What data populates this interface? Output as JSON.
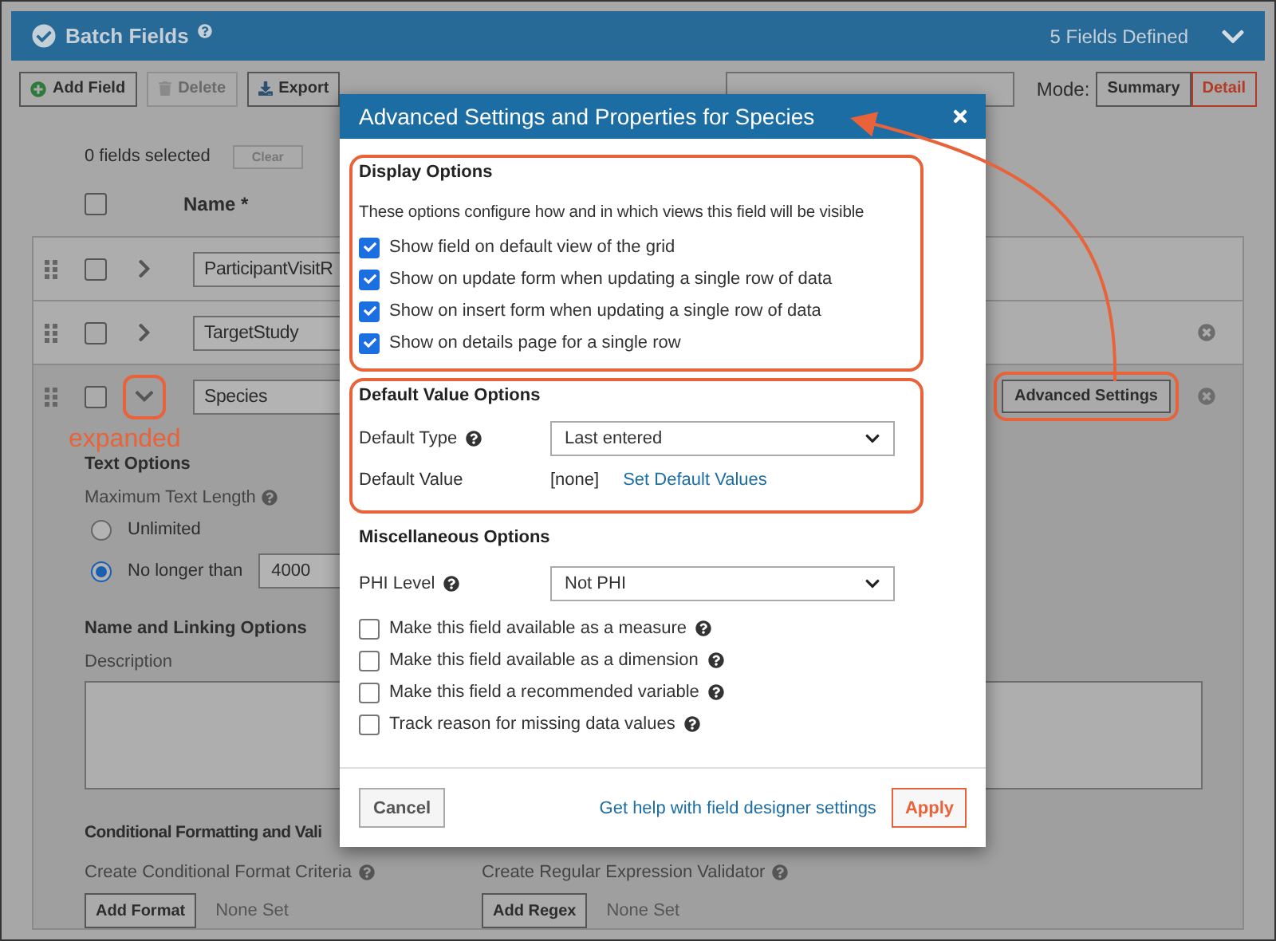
{
  "panel": {
    "title": "Batch Fields",
    "summary": "5 Fields Defined",
    "expanded": true
  },
  "toolbar": {
    "buttons": [
      {
        "label": "Add Field",
        "kind": "add",
        "disabled": false
      },
      {
        "label": "Delete",
        "kind": "delete",
        "disabled": true
      },
      {
        "label": "Export",
        "kind": "export",
        "disabled": false
      }
    ],
    "mode_label": "Mode:",
    "modes": [
      {
        "label": "Summary",
        "selected": false
      },
      {
        "label": "Detail",
        "selected": true
      }
    ]
  },
  "selection": {
    "count_text": "0 fields selected",
    "clear": "Clear"
  },
  "columns": {
    "name": "Name *",
    "select_all_checked": false
  },
  "fields": [
    {
      "name": "ParticipantVisitR",
      "checked": false,
      "expanded": false,
      "removable": false
    },
    {
      "name": "TargetStudy",
      "checked": false,
      "expanded": false,
      "removable": true
    },
    {
      "name": "Species",
      "checked": false,
      "expanded": true,
      "removable": true,
      "action": "Advanced Settings"
    }
  ],
  "details": {
    "text_options": {
      "title": "Text Options",
      "length_label": "Maximum Text Length",
      "options": [
        {
          "label": "Unlimited",
          "selected": false
        },
        {
          "label": "No longer than",
          "selected": true
        }
      ],
      "max_length": "4000"
    },
    "name_linking": {
      "title": "Name and Linking Options",
      "description_label": "Description"
    },
    "conditional": {
      "title": "Conditional Formatting and Vali",
      "format_label": "Create Conditional Format Criteria",
      "format_button": "Add Format",
      "format_status": "None Set",
      "regex_label": "Create Regular Expression Validator",
      "regex_button": "Add Regex",
      "regex_status": "None Set"
    }
  },
  "modal": {
    "title": "Advanced Settings and Properties for Species",
    "display": {
      "title": "Display Options",
      "description": "These options configure how and in which views this field will be visible",
      "options": [
        {
          "label": "Show field on default view of the grid",
          "checked": true
        },
        {
          "label": "Show on update form when updating a single row of data",
          "checked": true
        },
        {
          "label": "Show on insert form when updating a single row of data",
          "checked": true
        },
        {
          "label": "Show on details page for a single row",
          "checked": true
        }
      ]
    },
    "default_value": {
      "title": "Default Value Options",
      "type_label": "Default Type",
      "type_value": "Last entered",
      "value_label": "Default Value",
      "value": "[none]",
      "link": "Set Default Values"
    },
    "misc": {
      "title": "Miscellaneous Options",
      "phi_label": "PHI Level",
      "phi_value": "Not PHI",
      "options": [
        {
          "label": "Make this field available as a measure",
          "checked": false
        },
        {
          "label": "Make this field available as a dimension",
          "checked": false
        },
        {
          "label": "Make this field a recommended variable",
          "checked": false
        },
        {
          "label": "Track reason for missing data values",
          "checked": false
        }
      ]
    },
    "footer": {
      "cancel": "Cancel",
      "help_link": "Get help with field designer settings",
      "apply": "Apply"
    }
  },
  "annotation": {
    "callout": "expanded"
  }
}
